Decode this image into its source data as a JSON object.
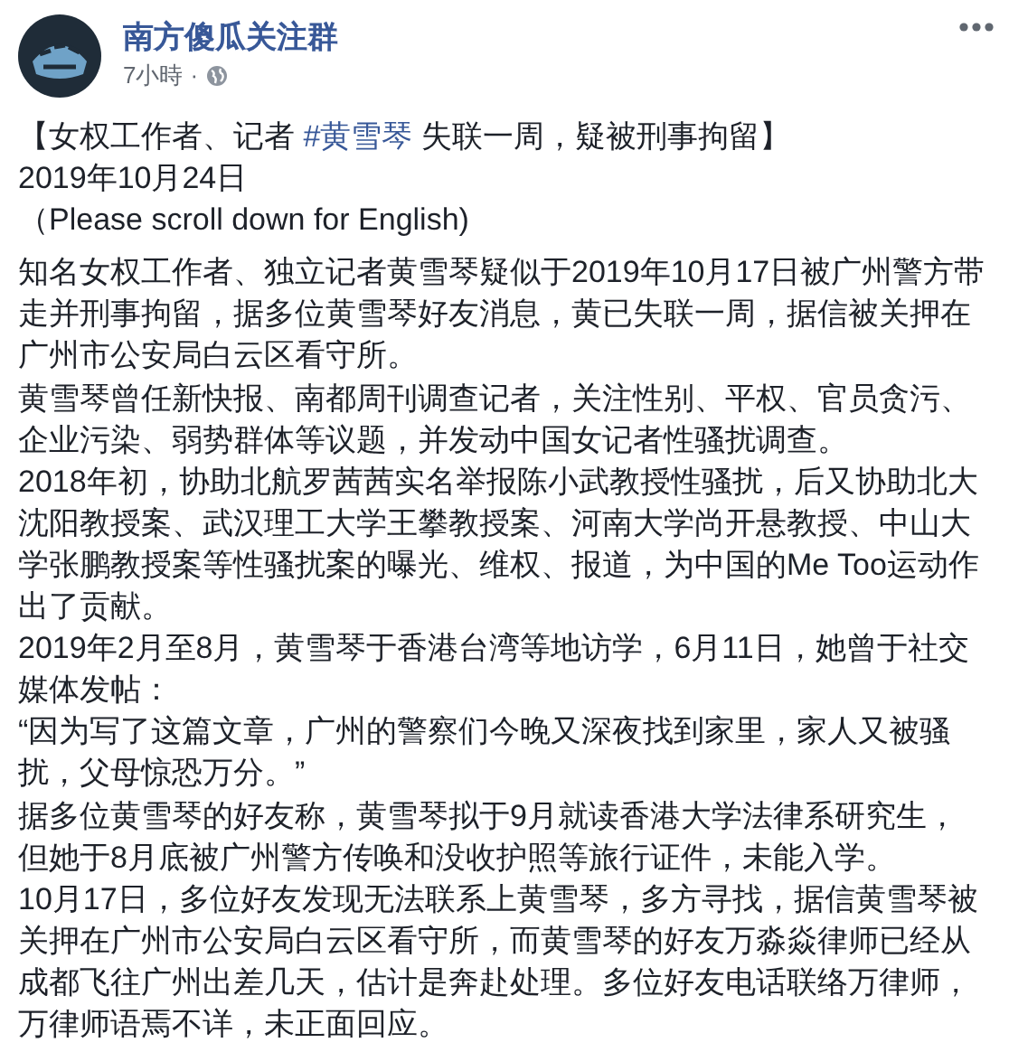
{
  "page": {
    "name": "南方傻瓜关注群",
    "time": "7小時",
    "separator": "·"
  },
  "post": {
    "headline": [
      {
        "kind": "text",
        "text": "【女权工作者、记者 "
      },
      {
        "kind": "hashtag",
        "text": "#黄雪琴"
      },
      {
        "kind": "text",
        "text": " 失联一周，疑被刑事拘留】"
      }
    ],
    "intro_lines": [
      "2019年10月24日",
      "（Please scroll down for English)"
    ],
    "paragraphs": [
      [
        "知名女权工作者、独立记者黄雪琴疑似于2019年10月17日被广州警方带",
        "走并刑事拘留，据多位黄雪琴好友消息，黄已失联一周，据信被关押在",
        "广州市公安局白云区看守所。"
      ],
      [
        "黄雪琴曾任新快报、南都周刊调查记者，关注性别、平权、官员贪污、",
        "企业污染、弱势群体等议题，并发动中国女记者性骚扰调查。"
      ],
      [
        "2018年初，协助北航罗茜茜实名举报陈小武教授性骚扰，后又协助北大",
        "沈阳教授案、武汉理工大学王攀教授案、河南大学尚开悬教授、中山大",
        "学张鹏教授案等性骚扰案的曝光、维权、报道，为中国的Me Too运动作",
        "出了贡献。"
      ],
      [
        "2019年2月至8月，黄雪琴于香港台湾等地访学，6月11日，她曾于社交",
        "媒体发帖："
      ],
      [
        "“因为写了这篇文章，广州的警察们今晚又深夜找到家里，家人又被骚",
        "扰，父母惊恐万分。”"
      ],
      [
        "据多位黄雪琴的好友称，黄雪琴拟于9月就读香港大学法律系研究生，",
        "但她于8月底被广州警方传唤和没收护照等旅行证件，未能入学。"
      ],
      [
        "10月17日，多位好友发现无法联系上黄雪琴，多方寻找，据信黄雪琴被",
        "关押在广州市公安局白云区看守所，而黄雪琴的好友万淼焱律师已经从",
        "成都飞往广州出差几天，估计是奔赴处理。多位好友电话联络万律师，",
        "万律师语焉不详，未正面回应。"
      ]
    ]
  }
}
